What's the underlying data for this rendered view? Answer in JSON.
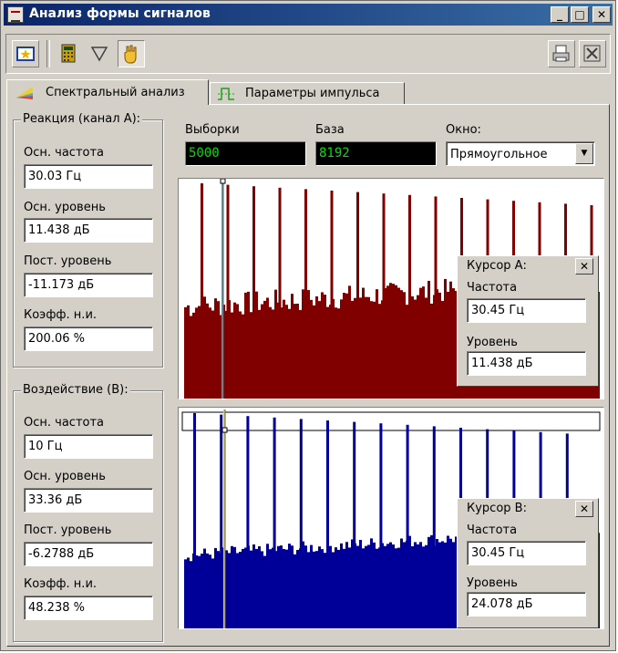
{
  "window": {
    "title": "Анализ формы сигналов",
    "minimize": "_",
    "maximize": "□",
    "close": "✕"
  },
  "toolbar": {
    "buttons": [
      {
        "name": "open-icon"
      },
      {
        "name": "calculator-icon"
      },
      {
        "name": "filter-icon"
      },
      {
        "name": "hand-icon"
      }
    ],
    "right_buttons": [
      {
        "name": "print-icon"
      },
      {
        "name": "exit-icon"
      }
    ]
  },
  "tabs": [
    {
      "label": "Спектральный анализ",
      "active": true
    },
    {
      "label": "Параметры импульса",
      "active": false
    }
  ],
  "reaction": {
    "title": "Реакция (канал А):",
    "fields": [
      {
        "label": "Осн. частота",
        "value": "30.03 Гц"
      },
      {
        "label": "Осн. уровень",
        "value": "11.438 дБ"
      },
      {
        "label": "Пост. уровень",
        "value": "-11.173 дБ"
      },
      {
        "label": "Коэфф. н.и.",
        "value": "200.06 %"
      }
    ]
  },
  "impact": {
    "title": "Воздействие (B):",
    "fields": [
      {
        "label": "Осн. частота",
        "value": "10 Гц"
      },
      {
        "label": "Осн. уровень",
        "value": "33.36 дБ"
      },
      {
        "label": "Пост. уровень",
        "value": "-6.2788 дБ"
      },
      {
        "label": "Коэфф. н.и.",
        "value": "48.238 %"
      }
    ]
  },
  "settings": {
    "samples_label": "Выборки",
    "samples_value": "5000",
    "base_label": "База",
    "base_value": "8192",
    "window_label": "Окно:",
    "window_value": "Прямоугольное"
  },
  "cursor_a": {
    "title": "Курсор А:",
    "freq_label": "Частота",
    "freq_value": "30.45 Гц",
    "level_label": "Уровень",
    "level_value": "11.438 дБ"
  },
  "cursor_b": {
    "title": "Курсор B:",
    "freq_label": "Частота",
    "freq_value": "30.45 Гц",
    "level_label": "Уровень",
    "level_value": "24.078 дБ"
  },
  "colors": {
    "spectrum_a": "#800000",
    "spectrum_b": "#000099",
    "cursor_a_line": "#40a0b0",
    "cursor_b_line": "#e0d040",
    "titlebar": "#0a246a"
  }
}
